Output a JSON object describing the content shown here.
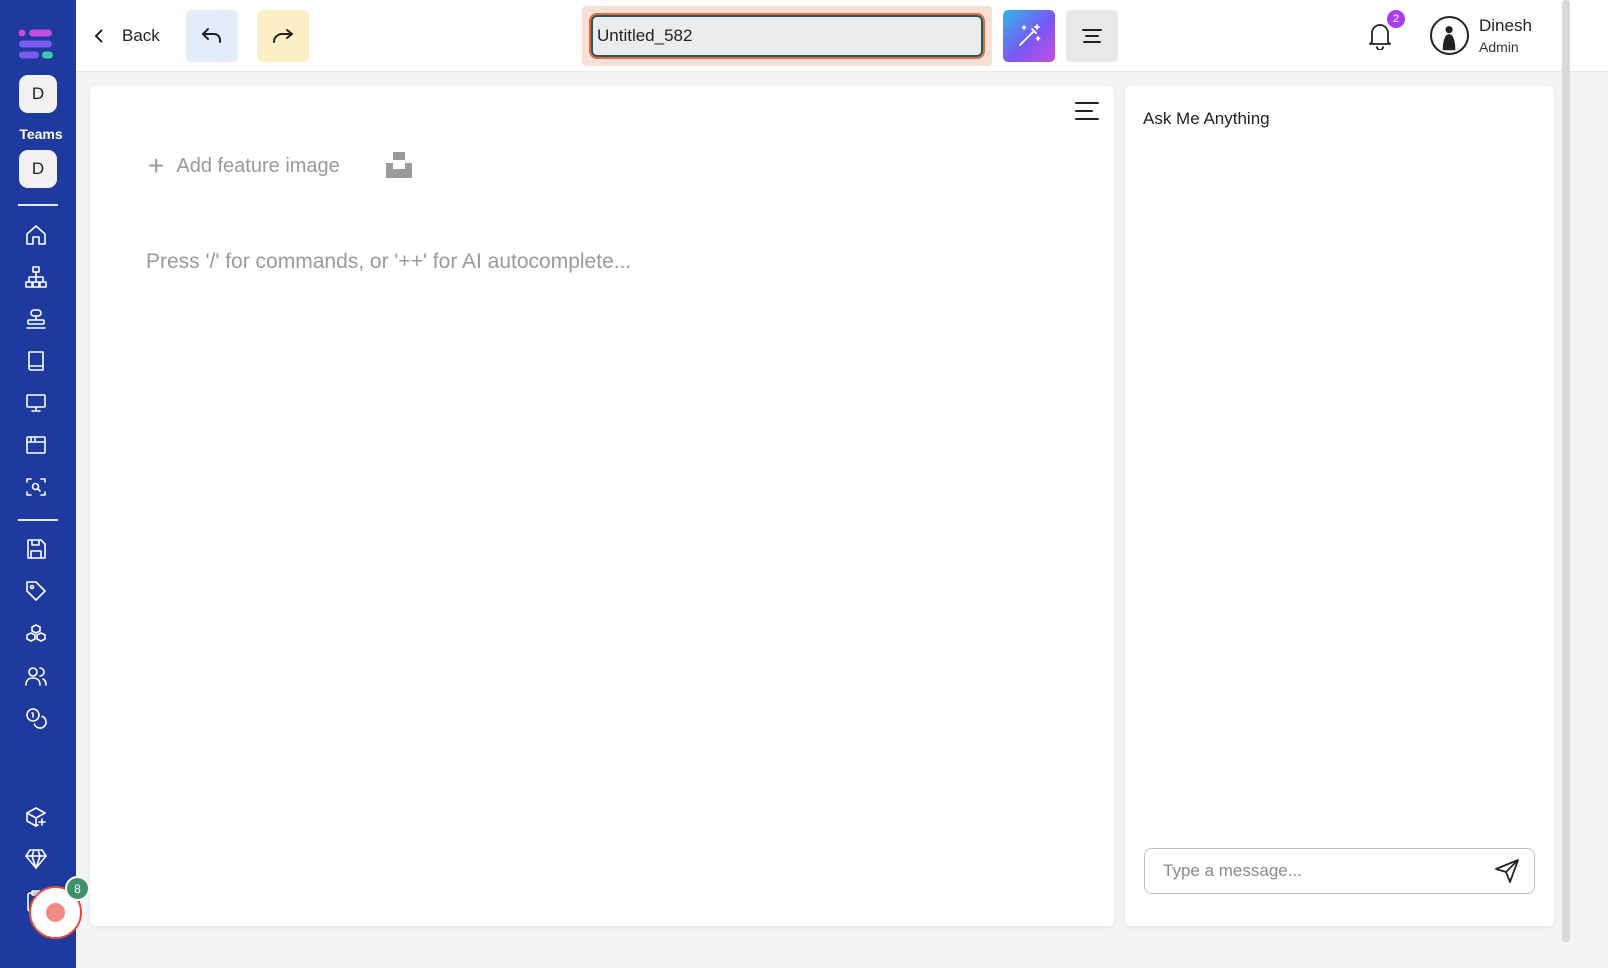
{
  "sidebar": {
    "workspace_top": "D",
    "teams_label": "Teams",
    "workspace_team": "D",
    "record_count": "8"
  },
  "toolbar": {
    "back_label": "Back",
    "document_title": "Untitled_582"
  },
  "notifications": {
    "count": "2"
  },
  "user": {
    "name": "Dinesh",
    "role": "Admin"
  },
  "editor": {
    "add_feature_label": "Add feature image",
    "placeholder": "Press '/' for commands, or '++' for AI autocomplete..."
  },
  "chat": {
    "title": "Ask Me Anything",
    "input_placeholder": "Type a message..."
  },
  "colors": {
    "sidebar": "#1e3a9e",
    "undo_bg": "#e3ecfb",
    "redo_bg": "#fcefc6",
    "title_focus": "#e3693d",
    "notification_badge": "#a83ef0",
    "record_badge": "#3f8f68"
  }
}
